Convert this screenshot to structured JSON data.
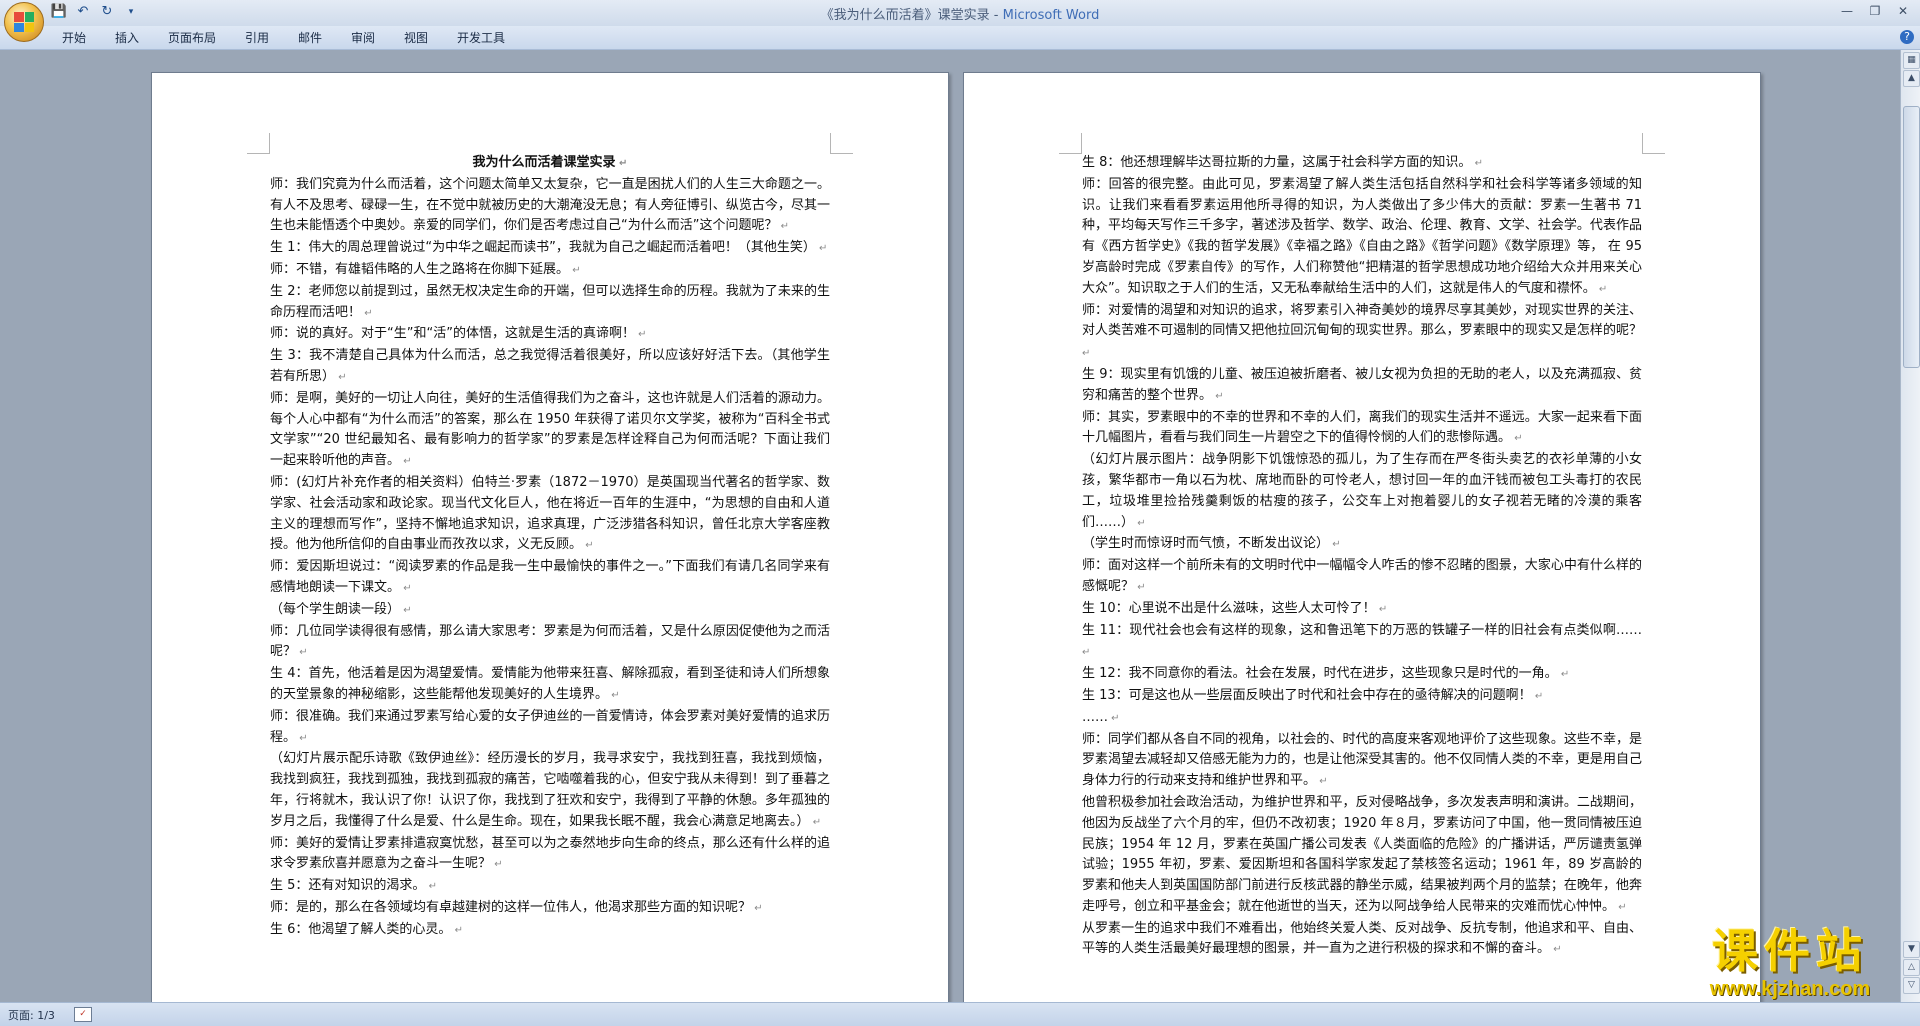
{
  "window": {
    "title_doc": "《我为什么而活着》课堂实录",
    "title_sep": " - ",
    "title_app": "Microsoft Word"
  },
  "quick_access": [
    "save-icon",
    "undo-icon",
    "redo-icon",
    "customize-icon"
  ],
  "ribbon": {
    "tabs": [
      "开始",
      "插入",
      "页面布局",
      "引用",
      "邮件",
      "审阅",
      "视图",
      "开发工具"
    ]
  },
  "page1": {
    "title": "我为什么而活着课堂实录",
    "paragraphs": [
      "师：我们究竟为什么而活着，这个问题太简单又太复杂，它一直是困扰人们的人生三大命题之一。有人不及思考、碌碌一生，在不觉中就被历史的大潮淹没无息；有人旁征博引、纵览古今，尽其一生也未能悟透个中奥妙。亲爱的同学们，你们是否考虑过自己“为什么而活”这个问题呢？",
      "生 1：伟大的周总理曾说过“为中华之崛起而读书”，我就为自己之崛起而活着吧！（其他生笑）",
      "师：不错，有雄韬伟略的人生之路将在你脚下延展。",
      "生 2：老师您以前提到过，虽然无权决定生命的开端，但可以选择生命的历程。我就为了未来的生命历程而活吧！",
      "师：说的真好。对于“生”和“活”的体悟，这就是生活的真谛啊！",
      "生 3：我不清楚自己具体为什么而活，总之我觉得活着很美好，所以应该好好活下去。（其他学生若有所思）",
      "师：是啊，美好的一切让人向往，美好的生活值得我们为之奋斗，这也许就是人们活着的源动力。每个人心中都有“为什么而活”的答案，那么在 1950 年获得了诺贝尔文学奖，被称为“百科全书式文学家”“20 世纪最知名、最有影响力的哲学家”的罗素是怎样诠释自己为何而活呢？下面让我们一起来聆听他的声音。",
      "师：(幻灯片补充作者的相关资料）伯特兰·罗素（1872－1970）是英国现当代著名的哲学家、数学家、社会活动家和政论家。现当代文化巨人，他在将近一百年的生涯中，“为思想的自由和人道主义的理想而写作”，坚持不懈地追求知识，追求真理，广泛涉猎各科知识，曾任北京大学客座教授。他为他所信仰的自由事业而孜孜以求，义无反顾。",
      "师：爱因斯坦说过：“阅读罗素的作品是我一生中最愉快的事件之一。”下面我们有请几名同学来有感情地朗读一下课文。",
      "（每个学生朗读一段）",
      "师：几位同学读得很有感情，那么请大家思考：罗素是为何而活着，又是什么原因促使他为之而活呢？",
      "生 4：首先，他活着是因为渴望爱情。爱情能为他带来狂喜、解除孤寂，看到圣徒和诗人们所想象的天堂景象的神秘缩影，这些能帮他发现美好的人生境界。",
      "师：很准确。我们来通过罗素写给心爱的女子伊迪丝的一首爱情诗，体会罗素对美好爱情的追求历程。",
      "（幻灯片展示配乐诗歌《致伊迪丝》：经历漫长的岁月，我寻求安宁，我找到狂喜，我找到烦恼，我找到疯狂，我找到孤独，我找到孤寂的痛苦，它啮噬着我的心，但安宁我从未得到！到了垂暮之年，行将就木，我认识了你！认识了你，我找到了狂欢和安宁，我得到了平静的休憩。多年孤独的岁月之后，我懂得了什么是爱、什么是生命。现在，如果我长眠不醒，我会心满意足地离去。）",
      "师：美好的爱情让罗素排遣寂寞忧愁，甚至可以为之泰然地步向生命的终点，那么还有什么样的追求令罗素欣喜并愿意为之奋斗一生呢？",
      "生 5：还有对知识的渴求。",
      "师：是的，那么在各领域均有卓越建树的这样一位伟人，他渴求那些方面的知识呢？",
      "生 6：他渴望了解人类的心灵。"
    ]
  },
  "page2": {
    "paragraphs": [
      "生 8：他还想理解毕达哥拉斯的力量，这属于社会科学方面的知识。",
      "师：回答的很完整。由此可见，罗素渴望了解人类生活包括自然科学和社会科学等诸多领域的知识。让我们来看看罗素运用他所寻得的知识，为人类做出了多少伟大的贡献：罗素一生著书 71 种，平均每天写作三千多字，著述涉及哲学、数学、政治、伦理、教育、文学、社会学。代表作品有《西方哲学史》《我的哲学发展》《幸福之路》《自由之路》《哲学问题》《数学原理》等， 在 95 岁高龄时完成《罗素自传》的写作，人们称赞他“把精湛的哲学思想成功地介绍给大众并用来关心大众”。知识取之于人们的生活，又无私奉献给生活中的人们，这就是伟人的气度和襟怀。",
      "师：对爱情的渴望和对知识的追求，将罗素引入神奇美妙的境界尽享其美妙，对现实世界的关注、对人类苦难不可遏制的同情又把他拉回沉甸甸的现实世界。那么，罗素眼中的现实又是怎样的呢？",
      "生 9：现实里有饥饿的儿童、被压迫被折磨者、被儿女视为负担的无助的老人，以及充满孤寂、贫穷和痛苦的整个世界。",
      "师：其实，罗素眼中的不幸的世界和不幸的人们，离我们的现实生活并不遥远。大家一起来看下面十几幅图片，看看与我们同生一片碧空之下的值得怜悯的人们的悲惨际遇。",
      "（幻灯片展示图片：战争阴影下饥饿惊恐的孤儿，为了生存而在严冬街头卖艺的衣衫单薄的小女孩，繁华都市一角以石为枕、席地而卧的可怜老人，想讨回一年的血汗钱而被包工头毒打的农民工，垃圾堆里捡拾残羹剩饭的枯瘦的孩子，公交车上对抱着婴儿的女子视若无睹的冷漠的乘客们……）",
      "（学生时而惊讶时而气愤，不断发出议论）",
      "师：面对这样一个前所未有的文明时代中一幅幅令人咋舌的惨不忍睹的图景，大家心中有什么样的感慨呢？",
      "生 10：心里说不出是什么滋味，这些人太可怜了！",
      "生 11：现代社会也会有这样的现象，这和鲁迅笔下的万恶的铁罐子一样的旧社会有点类似啊……",
      "生 12：我不同意你的看法。社会在发展，时代在进步，这些现象只是时代的一角。",
      "生 13：可是这也从一些层面反映出了时代和社会中存在的亟待解决的问题啊！",
      "……",
      "师：同学们都从各自不同的视角，以社会的、时代的高度来客观地评价了这些现象。这些不幸，是罗素渴望去减轻却又倍感无能为力的，也是让他深受其害的。他不仅同情人类的不幸，更是用自己身体力行的行动来支持和维护世界和平。",
      "他曾积极参加社会政治活动，为维护世界和平，反对侵略战争，多次发表声明和演讲。二战期间，他因为反战坐了六个月的牢，但仍不改初衷；1920 年８月，罗素访问了中国，他一贯同情被压迫民族；1954 年 12 月，罗素在英国广播公司发表《人类面临的危险》的广播讲话，严厉谴责氢弹试验；1955 年初，罗素、爱因斯坦和各国科学家发起了禁核签名运动；1961 年，89 岁高龄的罗素和他夫人到英国国防部门前进行反核武器的静坐示威，结果被判两个月的监禁；在晚年，他奔走呼号，创立和平基金会；就在他逝世的当天，还为以阿战争给人民带来的灾难而忧心忡忡。",
      "从罗素一生的追求中我们不难看出，他始终关爱人类、反对战争、反抗专制，他追求和平、自由、平等的人类生活最美好最理想的图景，并一直为之进行积极的探求和不懈的奋斗。"
    ]
  },
  "statusbar": {
    "pages": "页面: 1/3"
  },
  "watermark": {
    "text": "课件站",
    "url": "www.kjzhan.com"
  }
}
